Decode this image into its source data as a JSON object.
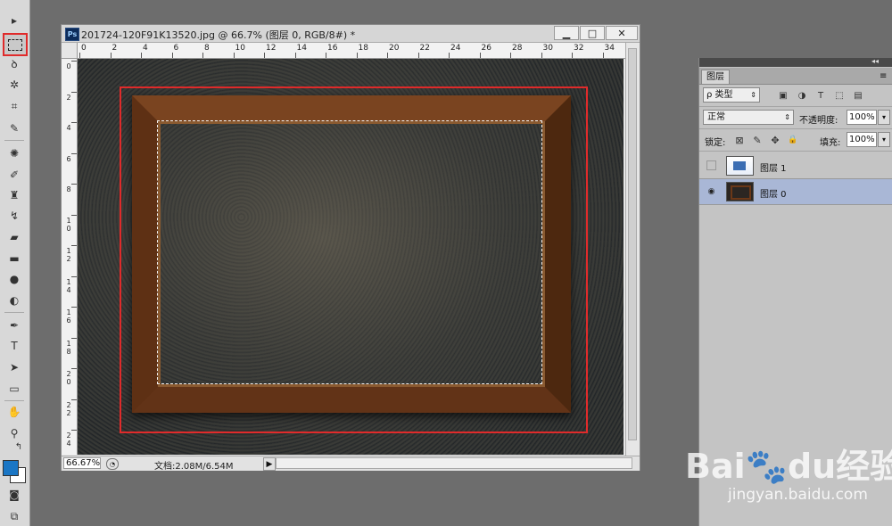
{
  "document": {
    "title": "201724-120F91K13520.jpg @ 66.7% (图层 0, RGB/8#) *",
    "app_badge": "Ps",
    "window_buttons": {
      "minimize": "▁",
      "maximize": "□",
      "close": "✕"
    },
    "ruler_h_labels": [
      "0",
      "2",
      "4",
      "6",
      "8",
      "10",
      "12",
      "14",
      "16",
      "18",
      "20",
      "22",
      "24",
      "26",
      "28",
      "30",
      "32",
      "34"
    ],
    "ruler_v_labels": [
      "0",
      "2",
      "4",
      "6",
      "8",
      "1\n0",
      "1\n2",
      "1\n4",
      "1\n6",
      "1\n8",
      "2\n0",
      "2\n2",
      "2\n4"
    ],
    "status": {
      "zoom": "66.67%",
      "doc_size": "文档:2.08M/6.54M",
      "arrow": "▶"
    }
  },
  "toolbar": {
    "tools": [
      {
        "name": "move-tool",
        "glyph": "▸"
      },
      {
        "name": "rectangular-marquee-tool",
        "glyph": "",
        "active": true
      },
      {
        "name": "lasso-tool",
        "glyph": "ꝺ"
      },
      {
        "name": "quick-selection-tool",
        "glyph": "✲"
      },
      {
        "name": "crop-tool",
        "glyph": "⌗"
      },
      {
        "name": "eyedropper-tool",
        "glyph": "✎"
      },
      {
        "name": "spot-healing-tool",
        "glyph": "✺"
      },
      {
        "name": "brush-tool",
        "glyph": "✐"
      },
      {
        "name": "clone-stamp-tool",
        "glyph": "♜"
      },
      {
        "name": "history-brush-tool",
        "glyph": "↯"
      },
      {
        "name": "eraser-tool",
        "glyph": "▰"
      },
      {
        "name": "gradient-tool",
        "glyph": "▬"
      },
      {
        "name": "blur-tool",
        "glyph": "●"
      },
      {
        "name": "dodge-tool",
        "glyph": "◐"
      },
      {
        "name": "pen-tool",
        "glyph": "✒"
      },
      {
        "name": "type-tool",
        "glyph": "T"
      },
      {
        "name": "path-selection-tool",
        "glyph": "➤"
      },
      {
        "name": "shape-tool",
        "glyph": "▭"
      },
      {
        "name": "hand-tool",
        "glyph": "✋"
      },
      {
        "name": "zoom-tool",
        "glyph": "⚲"
      }
    ],
    "swap_glyph": "↰",
    "quickmask_glyph": "◙",
    "screenmode_glyph": "⧉",
    "foreground_color": "#1a76c5",
    "background_color": "#ffffff"
  },
  "layers_panel": {
    "collapse_arrows": "◂◂",
    "tab_label": "图层",
    "menu_glyph": "≡",
    "filter_kind": "ρ 类型",
    "filter_icons": [
      "image-filter-icon",
      "adjustment-filter-icon",
      "type-filter-icon",
      "shape-filter-icon",
      "smart-object-filter-icon"
    ],
    "filter_glyphs": [
      "▣",
      "◑",
      "T",
      "⬚",
      "▤"
    ],
    "blend_mode": "正常",
    "opacity_label": "不透明度:",
    "opacity_value": "100%",
    "lock_label": "锁定:",
    "lock_glyphs": [
      "⊠",
      "✎",
      "✥",
      "🔒"
    ],
    "fill_label": "填充:",
    "fill_value": "100%",
    "layers": [
      {
        "name": "图层 1",
        "visible": false,
        "selected": false
      },
      {
        "name": "图层 0",
        "visible": true,
        "selected": true
      }
    ],
    "eye_glyph": "◉"
  },
  "watermark": {
    "logo": "Bai🐾du经验",
    "url": "jingyan.baidu.com"
  }
}
